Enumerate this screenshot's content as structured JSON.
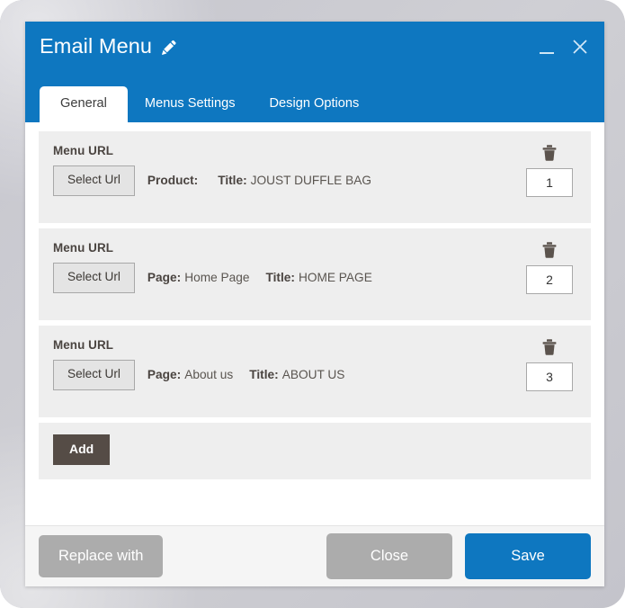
{
  "window": {
    "title": "Email Menu",
    "edit_icon": "pencil-icon",
    "minimize_icon": "minimize-icon",
    "close_icon": "close-icon",
    "accent_color": "#0e77c0",
    "dark_button_color": "#554c46",
    "muted_button_color": "#acacac"
  },
  "tabs": [
    {
      "label": "General",
      "active": true
    },
    {
      "label": "Menus Settings",
      "active": false
    },
    {
      "label": "Design Options",
      "active": false
    }
  ],
  "rows": [
    {
      "label": "Menu URL",
      "select_button": "Select Url",
      "type_key": "Product:",
      "type_value": "",
      "title_key": "Title:",
      "title_value": "JOUST DUFFLE BAG",
      "order": "1",
      "delete_icon": "trash-icon"
    },
    {
      "label": "Menu URL",
      "select_button": "Select Url",
      "type_key": "Page:",
      "type_value": "Home Page",
      "title_key": "Title:",
      "title_value": "HOME PAGE",
      "order": "2",
      "delete_icon": "trash-icon"
    },
    {
      "label": "Menu URL",
      "select_button": "Select Url",
      "type_key": "Page:",
      "type_value": "About us",
      "title_key": "Title:",
      "title_value": "ABOUT US",
      "order": "3",
      "delete_icon": "trash-icon"
    }
  ],
  "add": {
    "label": "Add"
  },
  "footer": {
    "replace_with": "Replace with",
    "close": "Close",
    "save": "Save"
  }
}
